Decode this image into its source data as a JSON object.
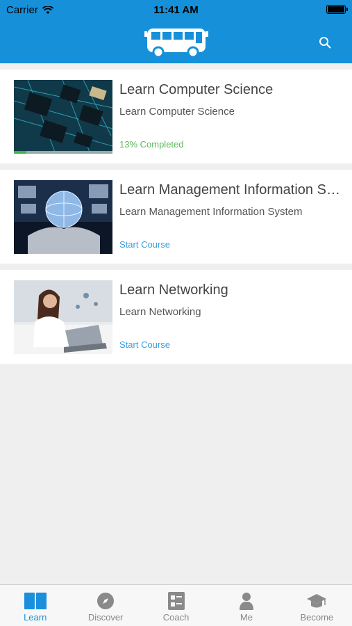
{
  "status_bar": {
    "carrier": "Carrier",
    "time": "11:41 AM",
    "battery": "full"
  },
  "navbar": {
    "logo": "bus-icon",
    "search_icon": "search-icon"
  },
  "courses": [
    {
      "title": "Learn Computer Science",
      "subtitle": "Learn Computer Science",
      "status": "13% Completed",
      "progress": 0.13,
      "image": "circuit-board"
    },
    {
      "title": "Learn Management Information System",
      "subtitle": "Learn Management Information System",
      "status": "Start Course",
      "progress": 0,
      "image": "globe-in-hands"
    },
    {
      "title": "Learn Networking",
      "subtitle": "Learn Networking",
      "status": "Start Course",
      "progress": 0,
      "image": "woman-laptop"
    }
  ],
  "tabs": [
    {
      "label": "Learn",
      "icon": "book-icon",
      "active": true
    },
    {
      "label": "Discover",
      "icon": "compass-icon",
      "active": false
    },
    {
      "label": "Coach",
      "icon": "checklist-icon",
      "active": false
    },
    {
      "label": "Me",
      "icon": "person-icon",
      "active": false
    },
    {
      "label": "Become",
      "icon": "graduation-cap-icon",
      "active": false
    }
  ],
  "colors": {
    "accent": "#1590d9",
    "progress": "#3fb649",
    "start_link": "#3a9ee0",
    "completed": "#5cb85c"
  }
}
